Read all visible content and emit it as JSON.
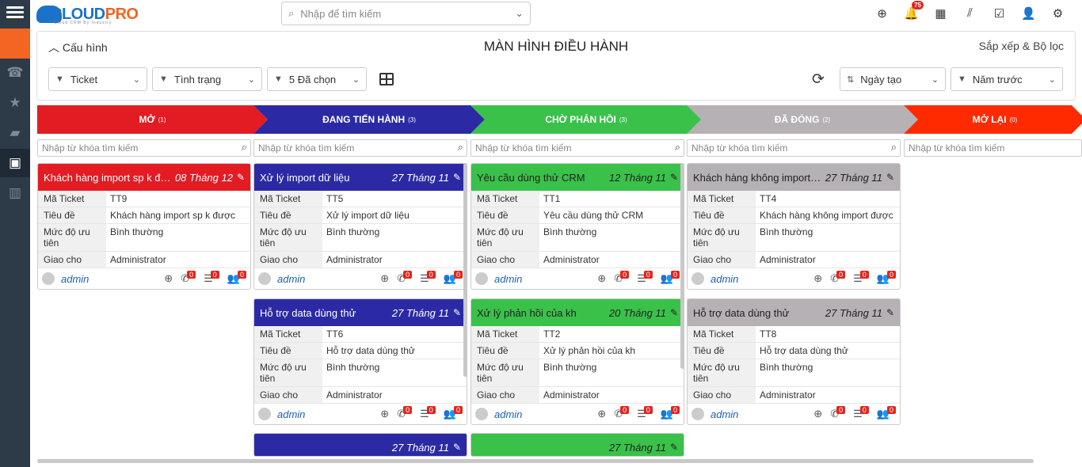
{
  "logo": {
    "part1": "CLOUD",
    "part2": "PRO",
    "tagline": "Cloud CRM By Industry"
  },
  "search": {
    "placeholder": "Nhập để tìm kiếm"
  },
  "notifications": {
    "count": "75"
  },
  "panel": {
    "config_label": "Cấu hình",
    "title": "MÀN HÌNH ĐIỀU HÀNH",
    "sort_filter_label": "Sắp xếp & Bộ lọc"
  },
  "filters": {
    "module": "Ticket",
    "status": "Tình trạng",
    "selected": "5 Đã chọn",
    "sort_by": "Ngày tạo",
    "period": "Năm trước"
  },
  "colors": {
    "open": "#e31b23",
    "in_progress": "#2b2aa4",
    "waiting": "#3ac14a",
    "closed": "#b5b1b5",
    "reopened": "#ff2a00"
  },
  "columns": [
    {
      "name": "MỞ",
      "count": "(1)",
      "search_placeholder": "Nhập từ khóa tìm kiếm"
    },
    {
      "name": "ĐANG TIẾN HÀNH",
      "count": "(3)",
      "search_placeholder": "Nhập từ khóa tìm kiếm"
    },
    {
      "name": "CHỜ PHẢN HỒI",
      "count": "(3)",
      "search_placeholder": "Nhập từ khóa tìm kiếm"
    },
    {
      "name": "ĐÃ ĐÓNG",
      "count": "(2)",
      "search_placeholder": "Nhập từ khóa tìm kiếm"
    },
    {
      "name": "MỞ LẠI",
      "count": "(0)",
      "search_placeholder": "Nhập từ khóa tìm kiếm"
    }
  ],
  "field_labels": {
    "code": "Mã Ticket",
    "subject": "Tiêu đề",
    "priority": "Mức độ ưu tiên",
    "assignee": "Giao cho"
  },
  "cards": [
    {
      "title": "Khách hàng import sp k được",
      "date": "08 Tháng 12",
      "code": "TT9",
      "subject": "Khách hàng import sp k được",
      "priority": "Bình thường",
      "assignee": "Administrator",
      "user": "admin",
      "c1": "0",
      "c2": "0",
      "c3": "0"
    },
    {
      "title": "Xử lý import dữ liệu",
      "date": "27 Tháng 11",
      "code": "TT5",
      "subject": "Xử lý import dữ liệu",
      "priority": "Bình thường",
      "assignee": "Administrator",
      "user": "admin",
      "c1": "0",
      "c2": "0",
      "c3": "0"
    },
    {
      "title": "Hỗ trợ data dùng thử",
      "date": "27 Tháng 11",
      "code": "TT6",
      "subject": "Hỗ trợ data dùng thử",
      "priority": "Bình thường",
      "assignee": "Administrator",
      "user": "admin",
      "c1": "0",
      "c2": "0",
      "c3": "0"
    },
    {
      "title": "",
      "date": "27 Tháng 11"
    },
    {
      "title": "Yêu cầu dùng thử CRM",
      "date": "12 Tháng 11",
      "code": "TT1",
      "subject": "Yêu cầu dùng thử CRM",
      "priority": "Bình thường",
      "assignee": "Administrator",
      "user": "admin",
      "c1": "0",
      "c2": "0",
      "c3": "0"
    },
    {
      "title": "Xử lý phản hồi của kh",
      "date": "20 Tháng 11",
      "code": "TT2",
      "subject": "Xử lý phản hồi của kh",
      "priority": "Bình thường",
      "assignee": "Administrator",
      "user": "admin",
      "c1": "0",
      "c2": "0",
      "c3": "0"
    },
    {
      "title": "",
      "date": "27 Tháng 11"
    },
    {
      "title": "Khách hàng không import được",
      "date": "27 Tháng 11",
      "code": "TT4",
      "subject": "Khách hàng không import được",
      "priority": "Bình thường",
      "assignee": "Administrator",
      "user": "admin",
      "c1": "0",
      "c2": "0",
      "c3": "0"
    },
    {
      "title": "Hỗ trợ data dùng thử",
      "date": "27 Tháng 11",
      "code": "TT8",
      "subject": "Hỗ trợ data dùng thử",
      "priority": "Bình thường",
      "assignee": "Administrator",
      "user": "admin",
      "c1": "0",
      "c2": "0",
      "c3": "0"
    }
  ]
}
